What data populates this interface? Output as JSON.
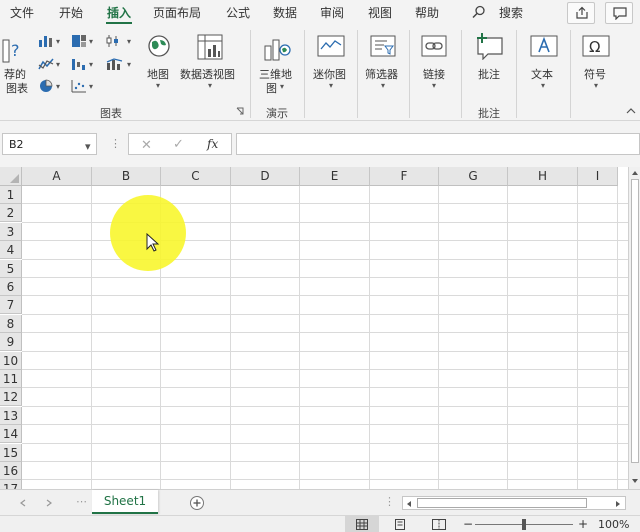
{
  "menu": {
    "tabs": [
      "文件",
      "开始",
      "插入",
      "页面布局",
      "公式",
      "数据",
      "审阅",
      "视图",
      "帮助"
    ],
    "active": "插入",
    "search": "搜索"
  },
  "ribbon": {
    "recommended_charts": [
      "荐的",
      "图表"
    ],
    "map": "地图",
    "pivot_chart": "数据透视图",
    "charts_group": "图表",
    "map3d": [
      "三维地",
      "图"
    ],
    "tours_group": "演示",
    "sparklines": "迷你图",
    "slicer": "筛选器",
    "link": "链接",
    "comment": "批注",
    "comments_group": "批注",
    "text": "文本",
    "symbol": "符号"
  },
  "formula_bar": {
    "name_box": "B2",
    "cancel": "✕",
    "enter": "✓",
    "fx": "fx",
    "value": ""
  },
  "grid": {
    "columns": [
      "A",
      "B",
      "C",
      "D",
      "E",
      "F",
      "G",
      "H",
      "I"
    ],
    "rows": [
      "1",
      "2",
      "3",
      "4",
      "5",
      "6",
      "7",
      "8",
      "9",
      "10",
      "11",
      "12",
      "13",
      "14",
      "15",
      "16",
      "17"
    ]
  },
  "sheet_tabs": {
    "tabs": [
      "Sheet1"
    ],
    "add": "+"
  },
  "status_bar": {
    "zoom_minus": "−",
    "zoom_plus": "+",
    "zoom": "100%"
  },
  "colors": {
    "accent": "#217346",
    "highlight": "#f8f628"
  }
}
